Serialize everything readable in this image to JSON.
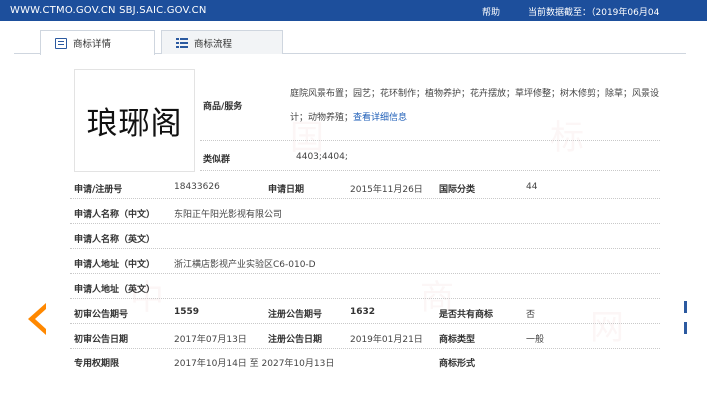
{
  "header": {
    "site": "WWW.CTMO.GOV.CN SBJ.SAIC.GOV.CN",
    "help": "帮助",
    "date_label": "当前数据截至：（2019年06月04"
  },
  "tabs": [
    {
      "label": "商标详情",
      "icon": "document-icon",
      "active": true
    },
    {
      "label": "商标流程",
      "icon": "list-icon",
      "active": false
    }
  ],
  "trademark": {
    "mark_text": "琅琊阁",
    "goods_label": "商品/服务",
    "goods_line1": "庭院风景布置；园艺；花环制作；植物养护；花卉摆放；草坪修整；树木修剪；除草；风景设",
    "goods_line2": "计；动物养殖；",
    "goods_link": "查看详细信息",
    "similar_label": "类似群",
    "similar_value": "4403;4404;"
  },
  "fields": {
    "reg_no_label": "申请/注册号",
    "reg_no": "18433626",
    "app_date_label": "申请日期",
    "app_date": "2015年11月26日",
    "intl_class_label": "国际分类",
    "intl_class": "44",
    "applicant_cn_label": "申请人名称（中文）",
    "applicant_cn": "东阳正午阳光影视有限公司",
    "applicant_en_label": "申请人名称（英文）",
    "applicant_en": "",
    "address_cn_label": "申请人地址（中文）",
    "address_cn": "浙江横店影视产业实验区C6-010-D",
    "address_en_label": "申请人地址（英文）",
    "address_en": "",
    "prelim_pub_no_label": "初审公告期号",
    "prelim_pub_no": "1559",
    "reg_pub_no_label": "注册公告期号",
    "reg_pub_no": "1632",
    "shared_label": "是否共有商标",
    "shared": "否",
    "prelim_pub_date_label": "初审公告日期",
    "prelim_pub_date": "2017年07月13日",
    "reg_pub_date_label": "注册公告日期",
    "reg_pub_date": "2019年01月21日",
    "mark_type_label": "商标类型",
    "mark_type": "一般",
    "exclusive_label": "专用权期限",
    "exclusive": "2017年10月14日 至 2027年10月13日",
    "form_label": "商标形式",
    "form": ""
  },
  "colors": {
    "header_bg": "#1d4f9c",
    "link": "#1f5fb8",
    "arrow": "#ff8800"
  },
  "watermark": [
    "中",
    "国",
    "商",
    "标",
    "网"
  ]
}
